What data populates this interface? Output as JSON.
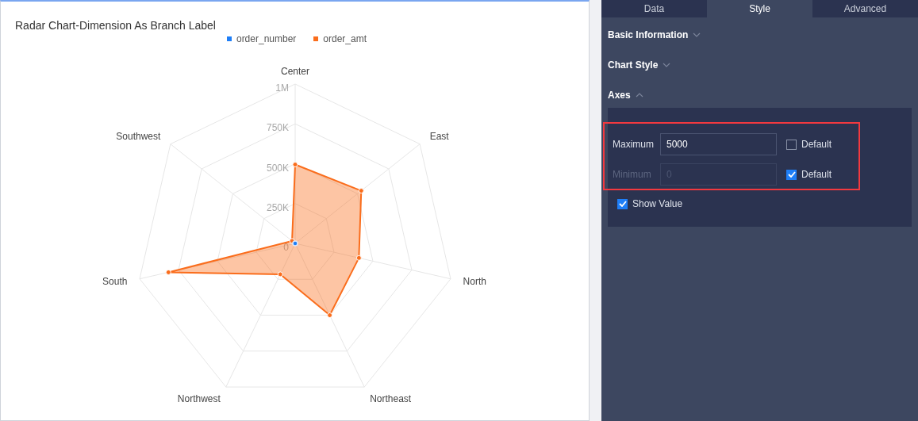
{
  "chart_panel": {
    "title": "Radar Chart-Dimension As Branch Label",
    "chart_data": {
      "type": "radar",
      "categories": [
        "Center",
        "East",
        "North",
        "Northeast",
        "Northwest",
        "South",
        "Southwest"
      ],
      "ylim": [
        0,
        1000000
      ],
      "yticks": [
        {
          "value": 0,
          "label": "0"
        },
        {
          "value": 250000,
          "label": "250K"
        },
        {
          "value": 500000,
          "label": "500K"
        },
        {
          "value": 750000,
          "label": "750K"
        },
        {
          "value": 1000000,
          "label": "1M"
        }
      ],
      "series": [
        {
          "name": "order_amt",
          "color": "#fa6d1c",
          "values": [
            495000,
            530000,
            410000,
            500000,
            215000,
            815000,
            25000
          ]
        }
      ]
    },
    "zero_series": [
      {
        "name": "order_number",
        "color": "#1e7ef7"
      }
    ]
  },
  "settings_panel": {
    "tabs": [
      {
        "label": "Data",
        "selected": false
      },
      {
        "label": "Style",
        "selected": true
      },
      {
        "label": "Advanced",
        "selected": false
      }
    ],
    "sections": [
      {
        "label": "Basic Information",
        "expanded": false
      },
      {
        "label": "Chart Style",
        "expanded": false
      },
      {
        "label": "Axes",
        "expanded": true
      }
    ],
    "axes": {
      "fields": [
        {
          "label": "Maximum",
          "value": "5000",
          "disabled": false,
          "default_label": "Default",
          "default_checked": false
        },
        {
          "label": "Minimum",
          "placeholder": "0",
          "disabled": true,
          "default_label": "Default",
          "default_checked": true
        }
      ],
      "show_value": {
        "label": "Show Value",
        "checked": true
      }
    }
  }
}
